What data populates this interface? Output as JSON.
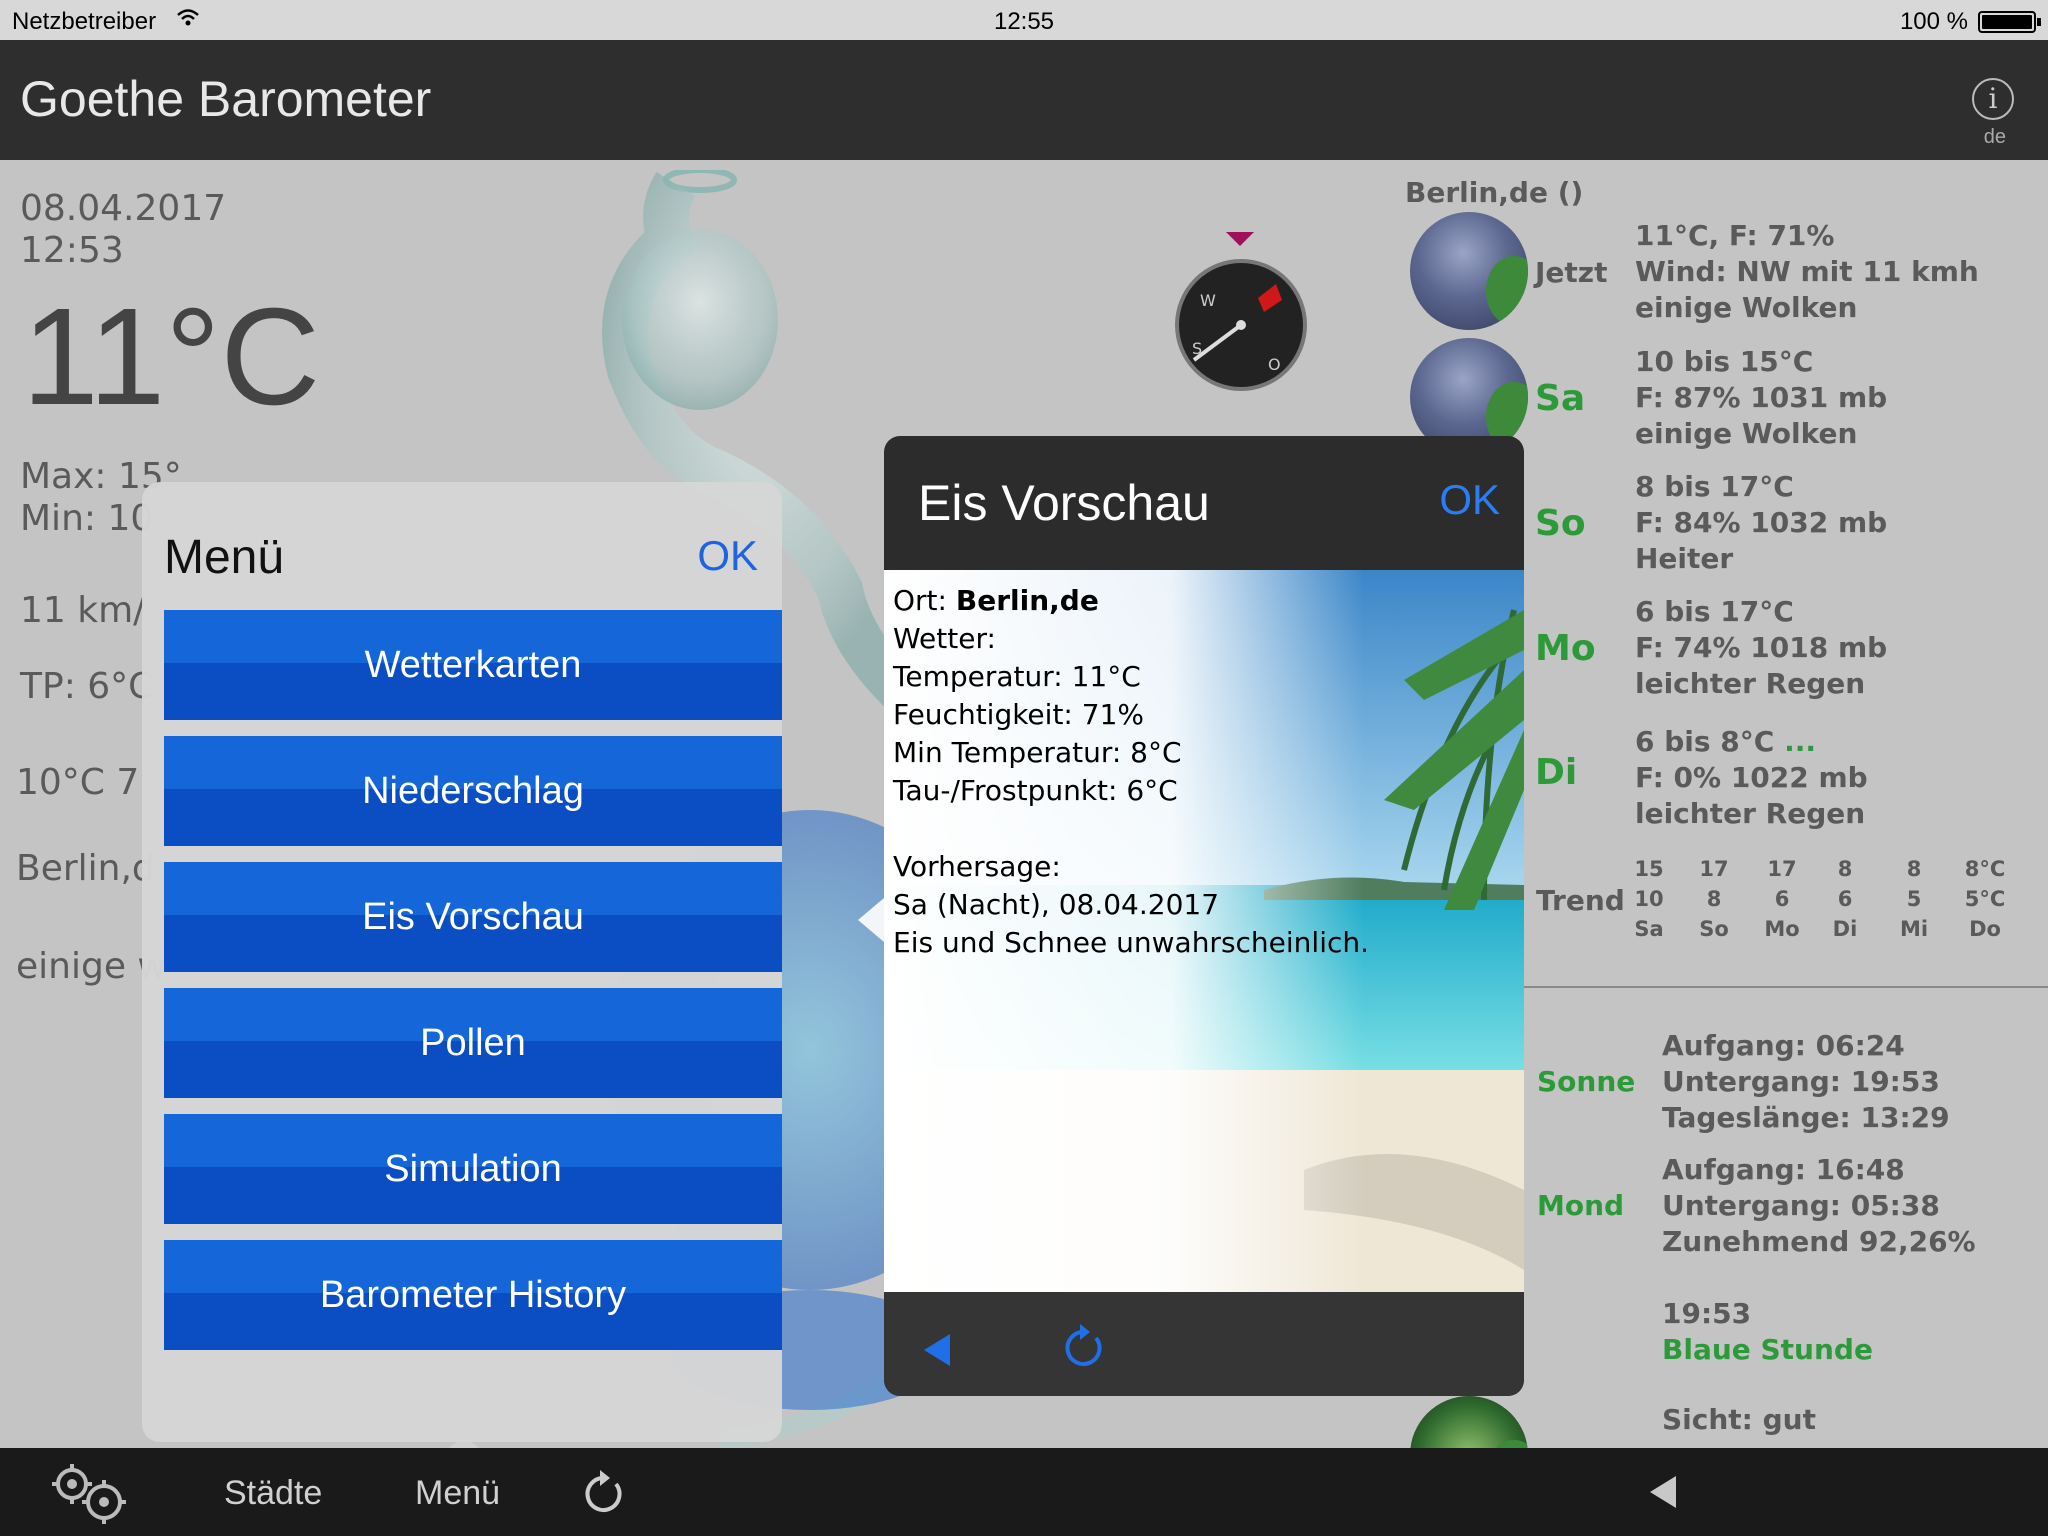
{
  "status_bar": {
    "carrier": "Netzbetreiber",
    "time": "12:55",
    "battery": "100 %"
  },
  "nav": {
    "title": "Goethe Barometer",
    "language": "de"
  },
  "left_panel": {
    "date": "08.04.2017",
    "time": "12:53",
    "temperature": "11°C",
    "max": "Max: 15°",
    "min": "Min: 10",
    "wind": "11 km/",
    "tp": "TP: 6°C",
    "obs": "10°C 7",
    "city": "Berlin,d",
    "condition": "einige w"
  },
  "weather": {
    "location": "Berlin,de ()",
    "now_label": "Jetzt",
    "now": [
      "11°C, F: 71%",
      "Wind: NW mit 11 kmh",
      "einige Wolken"
    ],
    "days": [
      {
        "label": "Sa",
        "lines": [
          "10 bis 15°C",
          "F: 87% 1031 mb",
          "einige Wolken"
        ]
      },
      {
        "label": "So",
        "lines": [
          "8 bis 17°C",
          "F: 84% 1032 mb",
          "Heiter"
        ]
      },
      {
        "label": "Mo",
        "lines": [
          "6 bis 17°C",
          "F: 74% 1018 mb",
          "leichter Regen"
        ]
      },
      {
        "label": "Di",
        "lines": [
          "6 bis 8°C",
          "F: 0% 1022 mb",
          "leichter Regen"
        ]
      }
    ],
    "more": "...",
    "trend_label": "Trend",
    "trend": [
      {
        "high": "15",
        "low": "10",
        "day": "Sa"
      },
      {
        "high": "17",
        "low": "8",
        "day": "So"
      },
      {
        "high": "17",
        "low": "6",
        "day": "Mo"
      },
      {
        "high": "8",
        "low": "6",
        "day": "Di"
      },
      {
        "high": "8",
        "low": "5",
        "day": "Mi"
      },
      {
        "high": "8°C",
        "low": "5°C",
        "day": "Do"
      }
    ],
    "sun_label": "Sonne",
    "sun": [
      "Aufgang: 06:24",
      "Untergang: 19:53",
      "Tageslänge: 13:29"
    ],
    "moon_label": "Mond",
    "moon": [
      "Aufgang: 16:48",
      "Untergang: 05:38",
      "Zunehmend 92,26%"
    ],
    "blue_hour_time": "19:53",
    "blue_hour_label": "Blaue Stunde",
    "visibility": "Sicht: gut"
  },
  "compass": {
    "west": "W",
    "south": "S",
    "east": "O"
  },
  "menu": {
    "title": "Menü",
    "ok": "OK",
    "items": [
      "Wetterkarten",
      "Niederschlag",
      "Eis Vorschau",
      "Pollen",
      "Simulation",
      "Barometer History"
    ]
  },
  "ice_preview": {
    "title": "Eis Vorschau",
    "ok": "OK",
    "ort_label": "Ort: ",
    "ort_value": "Berlin,de",
    "lines": [
      "Wetter:",
      "Temperatur: 11°C",
      "Feuchtigkeit: 71%",
      "Min Temperatur: 8°C",
      "Tau-/Frostpunkt: 6°C",
      "",
      "Vorhersage:",
      "Sa (Nacht), 08.04.2017",
      "Eis und Schnee unwahrscheinlich."
    ]
  },
  "toolbar": {
    "cities": "Städte",
    "menu": "Menü"
  },
  "colors": {
    "accent_blue": "#1e64e0",
    "menu_button": "#1566d8",
    "green_label": "#2d9a3a",
    "nav_bg": "#2e2e2e"
  }
}
